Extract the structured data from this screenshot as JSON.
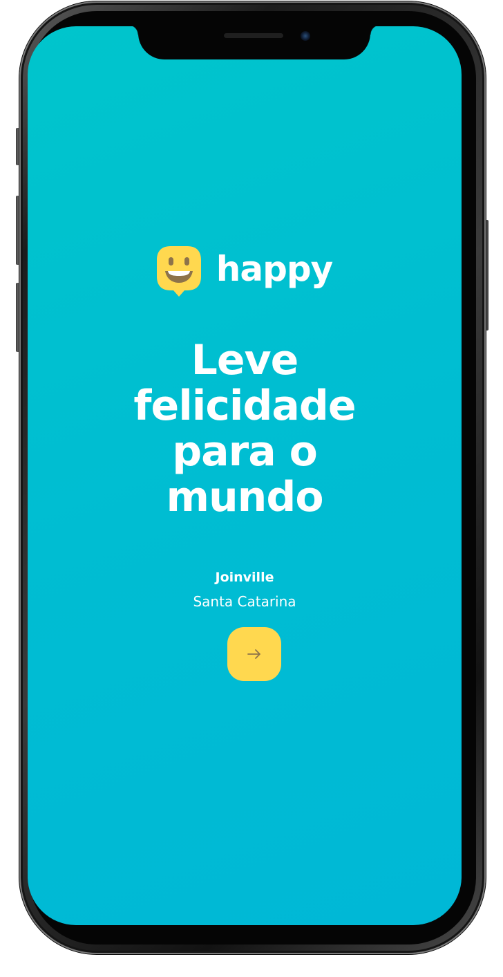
{
  "app": {
    "brand_name": "happy",
    "logo_icon": "smiling-speech-bubble-icon"
  },
  "hero": {
    "headline_lines": [
      "Leve",
      "felicidade",
      "para o",
      "mundo"
    ]
  },
  "location": {
    "city": "Joinville",
    "state": "Santa Catarina"
  },
  "actions": {
    "continue_icon": "arrow-right-icon"
  },
  "colors": {
    "background": "#00c0d0",
    "accent": "#ffd84f",
    "text": "#ffffff",
    "icon_dark": "#8d734a"
  }
}
